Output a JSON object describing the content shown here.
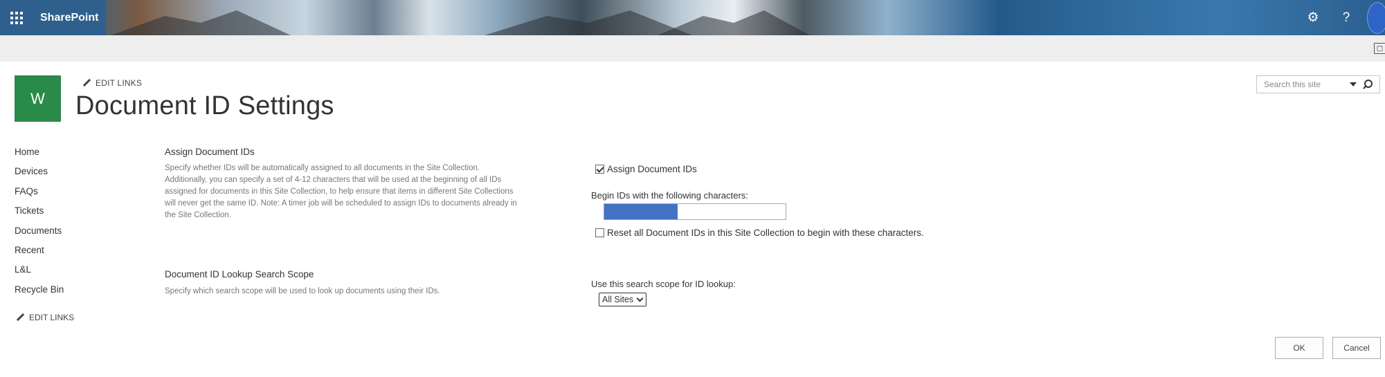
{
  "suite_bar": {
    "brand": "SharePoint",
    "settings_icon": "gear-icon",
    "help_label": "?",
    "app_launcher_icon": "waffle-icon"
  },
  "site": {
    "logo_letter": "W",
    "edit_links": "EDIT LINKS",
    "page_title": "Document ID Settings",
    "search_placeholder": "Search this site"
  },
  "quick_launch": {
    "items": [
      {
        "label": "Home"
      },
      {
        "label": "Devices"
      },
      {
        "label": "FAQs"
      },
      {
        "label": "Tickets"
      },
      {
        "label": "Documents"
      },
      {
        "label": "Recent"
      },
      {
        "label": "L&L"
      },
      {
        "label": "Recycle Bin"
      }
    ],
    "edit_links": "EDIT LINKS"
  },
  "assign_section": {
    "title": "Assign Document IDs",
    "description": "Specify whether IDs will be automatically assigned to all documents in the Site Collection. Additionally, you can specify a set of 4-12 characters that will be used at the beginning of all IDs assigned for documents in this Site Collection, to help ensure that items in different Site Collections will never get the same ID. Note: A timer job will be scheduled to assign IDs to documents already in the Site Collection.",
    "checkbox_label": "Assign Document IDs",
    "checkbox_checked": true,
    "begin_label": "Begin IDs with the following characters:",
    "prefix_value": "",
    "reset_label": "Reset all Document IDs in this Site Collection to begin with these characters.",
    "reset_checked": false
  },
  "lookup_section": {
    "title": "Document ID Lookup Search Scope",
    "description": "Specify which search scope will be used to look up documents using their IDs.",
    "scope_label": "Use this search scope for ID lookup:",
    "scope_selected": "All Sites"
  },
  "buttons": {
    "ok": "OK",
    "cancel": "Cancel"
  }
}
